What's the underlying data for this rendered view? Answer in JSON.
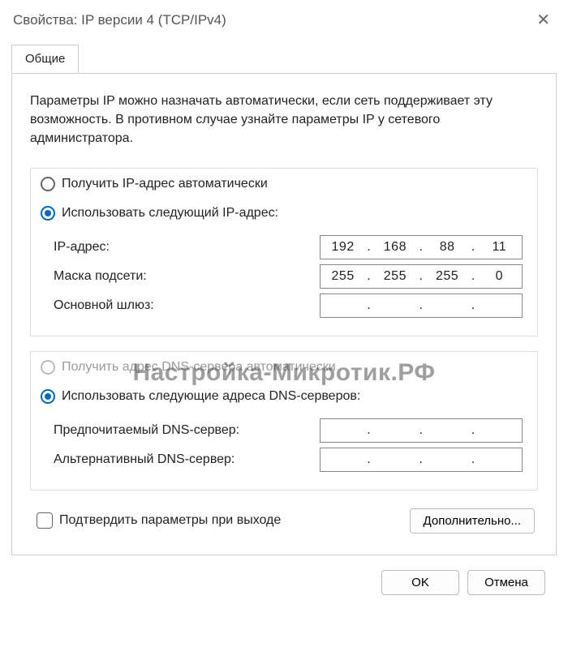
{
  "title": "Свойства: IP версии 4 (TCP/IPv4)",
  "tab_general": "Общие",
  "intro": "Параметры IP можно назначать автоматически, если сеть поддерживает эту возможность. В противном случае узнайте параметры IP у сетевого администратора.",
  "ip": {
    "radio_auto": "Получить IP-адрес автоматически",
    "radio_manual": "Использовать следующий IP-адрес:",
    "addr_label": "IP-адрес:",
    "addr": {
      "a": "192",
      "b": "168",
      "c": "88",
      "d": "11"
    },
    "mask_label": "Маска подсети:",
    "mask": {
      "a": "255",
      "b": "255",
      "c": "255",
      "d": "0"
    },
    "gw_label": "Основной шлюз:",
    "gw": {
      "a": "",
      "b": "",
      "c": "",
      "d": ""
    }
  },
  "dns": {
    "radio_auto": "Получить адрес DNS-сервера автоматически",
    "radio_manual": "Использовать следующие адреса DNS-серверов:",
    "pref_label": "Предпочитаемый DNS-сервер:",
    "pref": {
      "a": "",
      "b": "",
      "c": "",
      "d": ""
    },
    "alt_label": "Альтернативный DNS-сервер:",
    "alt": {
      "a": "",
      "b": "",
      "c": "",
      "d": ""
    }
  },
  "validate": "Подтвердить параметры при выходе",
  "advanced": "Дополнительно...",
  "ok": "OK",
  "cancel": "Отмена",
  "watermark": "Настройка-Микротик.РФ"
}
